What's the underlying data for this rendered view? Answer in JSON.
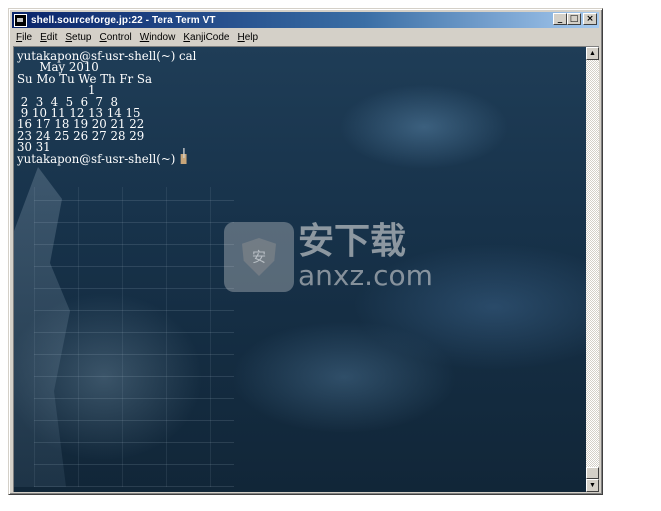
{
  "window": {
    "title": "shell.sourceforge.jp:22 - Tera Term VT",
    "buttons": {
      "minimize": "_",
      "maximize": "□",
      "close": "×"
    }
  },
  "menu": {
    "items": [
      {
        "accel": "F",
        "rest": "ile"
      },
      {
        "accel": "E",
        "rest": "dit"
      },
      {
        "accel": "S",
        "rest": "etup"
      },
      {
        "accel": "C",
        "rest": "ontrol"
      },
      {
        "accel": "W",
        "rest": "indow"
      },
      {
        "accel": "K",
        "rest": "anjiCode"
      },
      {
        "accel": "H",
        "rest": "elp"
      }
    ]
  },
  "terminal": {
    "lines": [
      "yutakapon@sf-usr-shell(~) cal",
      "      May 2010",
      "Su Mo Tu We Th Fr Sa",
      "                   1",
      " 2  3  4  5  6  7  8",
      " 9 10 11 12 13 14 15",
      "16 17 18 19 20 21 22",
      "23 24 25 26 27 28 29",
      "30 31"
    ],
    "prompt": "yutakapon@sf-usr-shell(~) ",
    "cursor_color": "#c8a67a",
    "background": "#17324a",
    "text_color": "#ffffff"
  },
  "watermark": {
    "chinese": "安下载",
    "latin": "anxz.com",
    "badge_char": "安"
  },
  "scrollbar": {
    "up_glyph": "▲",
    "down_glyph": "▼"
  }
}
